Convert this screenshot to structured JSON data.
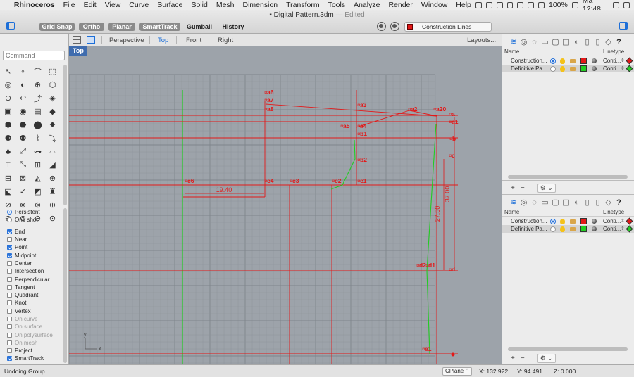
{
  "menubar": {
    "app_name": "Rhinoceros",
    "items": [
      "File",
      "Edit",
      "View",
      "Curve",
      "Surface",
      "Solid",
      "Mesh",
      "Dimension",
      "Transform",
      "Tools",
      "Analyze",
      "Render",
      "Window",
      "Help"
    ],
    "battery": "100%",
    "clock": "Ma 12:48"
  },
  "document": {
    "title": "Digital Pattern.3dm",
    "status": "— Edited"
  },
  "toolbar": {
    "grid_snap": "Grid Snap",
    "ortho": "Ortho",
    "planar": "Planar",
    "smart_track": "SmartTrack",
    "gumball": "Gumball",
    "history": "History",
    "current_layer": "Construction Lines",
    "current_layer_color": "#e31818"
  },
  "command": {
    "placeholder": "Command"
  },
  "tools": [
    "↖",
    "∘",
    "⌒",
    "⬚",
    "◎",
    "◐",
    "⊕",
    "⬡",
    "⊙",
    "↩",
    "⤴",
    "◈",
    "▣",
    "◉",
    "▤",
    "◆",
    "⬢",
    "⬣",
    "⬤",
    "⬥",
    "⚈",
    "⚉",
    "⌇",
    "⤵",
    "♣",
    "⤢",
    "⊶",
    "⌓",
    "T",
    "⤡",
    "⊞",
    "◢",
    "⊟",
    "⊠",
    "◭",
    "⊛",
    "⬕",
    "✓",
    "◩",
    "♜",
    "⊘",
    "⊗",
    "⊚",
    "⊕",
    "⊖",
    "⊜",
    "⊝",
    "⊙"
  ],
  "osnaps": {
    "mode": [
      {
        "label": "Persistent",
        "on": true
      },
      {
        "label": "One shot",
        "on": false
      }
    ],
    "items": [
      {
        "label": "End",
        "on": true,
        "dim": false
      },
      {
        "label": "Near",
        "on": false,
        "dim": false
      },
      {
        "label": "Point",
        "on": true,
        "dim": false
      },
      {
        "label": "Midpoint",
        "on": true,
        "dim": false
      },
      {
        "label": "Center",
        "on": false,
        "dim": false
      },
      {
        "label": "Intersection",
        "on": false,
        "dim": false
      },
      {
        "label": "Perpendicular",
        "on": false,
        "dim": false
      },
      {
        "label": "Tangent",
        "on": false,
        "dim": false
      },
      {
        "label": "Quadrant",
        "on": false,
        "dim": false
      },
      {
        "label": "Knot",
        "on": false,
        "dim": false
      },
      {
        "label": "Vertex",
        "on": false,
        "dim": false
      },
      {
        "label": "On curve",
        "on": false,
        "dim": true
      },
      {
        "label": "On surface",
        "on": false,
        "dim": true
      },
      {
        "label": "On polysurface",
        "on": false,
        "dim": true
      },
      {
        "label": "On mesh",
        "on": false,
        "dim": true
      },
      {
        "label": "Project",
        "on": false,
        "dim": false
      },
      {
        "label": "SmartTrack",
        "on": true,
        "dim": false
      }
    ]
  },
  "viewport": {
    "tabs": [
      "Perspective",
      "Top",
      "Front",
      "Right"
    ],
    "active_tab": "Top",
    "layouts": "Layouts...",
    "label": "Top",
    "axis_x": "x",
    "axis_y": "y",
    "curve_color": "#e31818",
    "pattern_color": "#22cc22",
    "points": [
      "a6",
      "a7",
      "a8",
      "a3",
      "a2",
      "a20",
      "a",
      "a1",
      "a5",
      "a4",
      "b1",
      "b",
      "b2",
      "c",
      "c6",
      "c4",
      "c3",
      "c2",
      "c1",
      "d2",
      "d1",
      "d",
      "e1"
    ],
    "dimensions": [
      "19.40",
      "27.50",
      "37.00"
    ]
  },
  "layers_panel": {
    "header_name": "Name",
    "header_linetype": "Linetype",
    "rows": [
      {
        "name": "Construction...",
        "current": true,
        "color": "#e31818",
        "linetype": "Conti...",
        "print_color": "#e31818"
      },
      {
        "name": "Definitive Pa...",
        "current": false,
        "color": "#22cc22",
        "linetype": "Conti...",
        "print_color": "#22cc22"
      }
    ]
  },
  "status": {
    "message": "Undoing Group",
    "cplane": "CPlane",
    "x": "X: 132.922",
    "y": "Y: 94.491",
    "z": "Z: 0.000"
  }
}
